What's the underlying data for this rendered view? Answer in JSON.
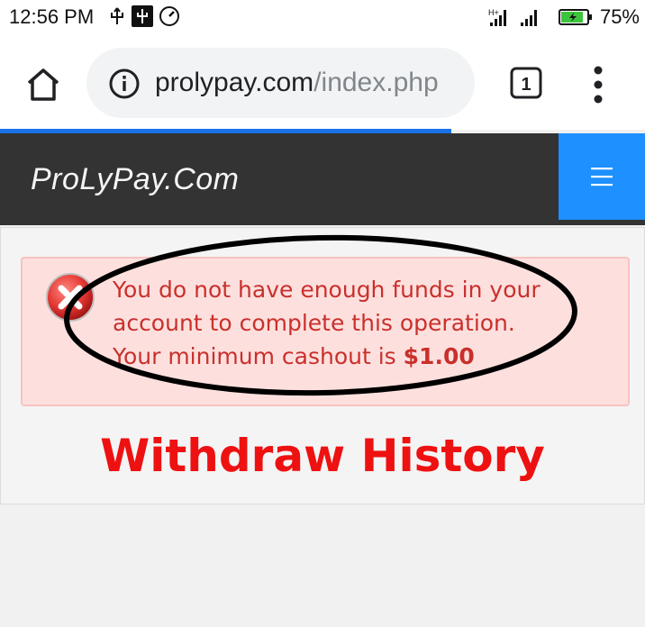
{
  "status_bar": {
    "time": "12:56 PM",
    "icons": [
      "usb-icon",
      "usb-debug-icon",
      "data-saver-icon"
    ],
    "signal": "H+",
    "battery_percent": "75%"
  },
  "browser": {
    "url_domain": "prolypay.com",
    "url_path": "/index.php",
    "tab_count": "1",
    "load_progress": 0.7
  },
  "site": {
    "brand": "ProLyPay.Com",
    "menu_icon": "hamburger-icon"
  },
  "alert": {
    "icon": "error-circle-icon",
    "message_line1": "You do not have enough funds in your",
    "message_line2": "account to complete this operation.",
    "message_line3_prefix": "Your minimum cashout is",
    "minimum_amount": "$1.00"
  },
  "page": {
    "title": "Withdraw History"
  },
  "colors": {
    "navbar": "#333333",
    "menu_button": "#1e90ff",
    "alert_bg": "#fde0de",
    "alert_text": "#c9302c",
    "title": "#ee1111"
  }
}
